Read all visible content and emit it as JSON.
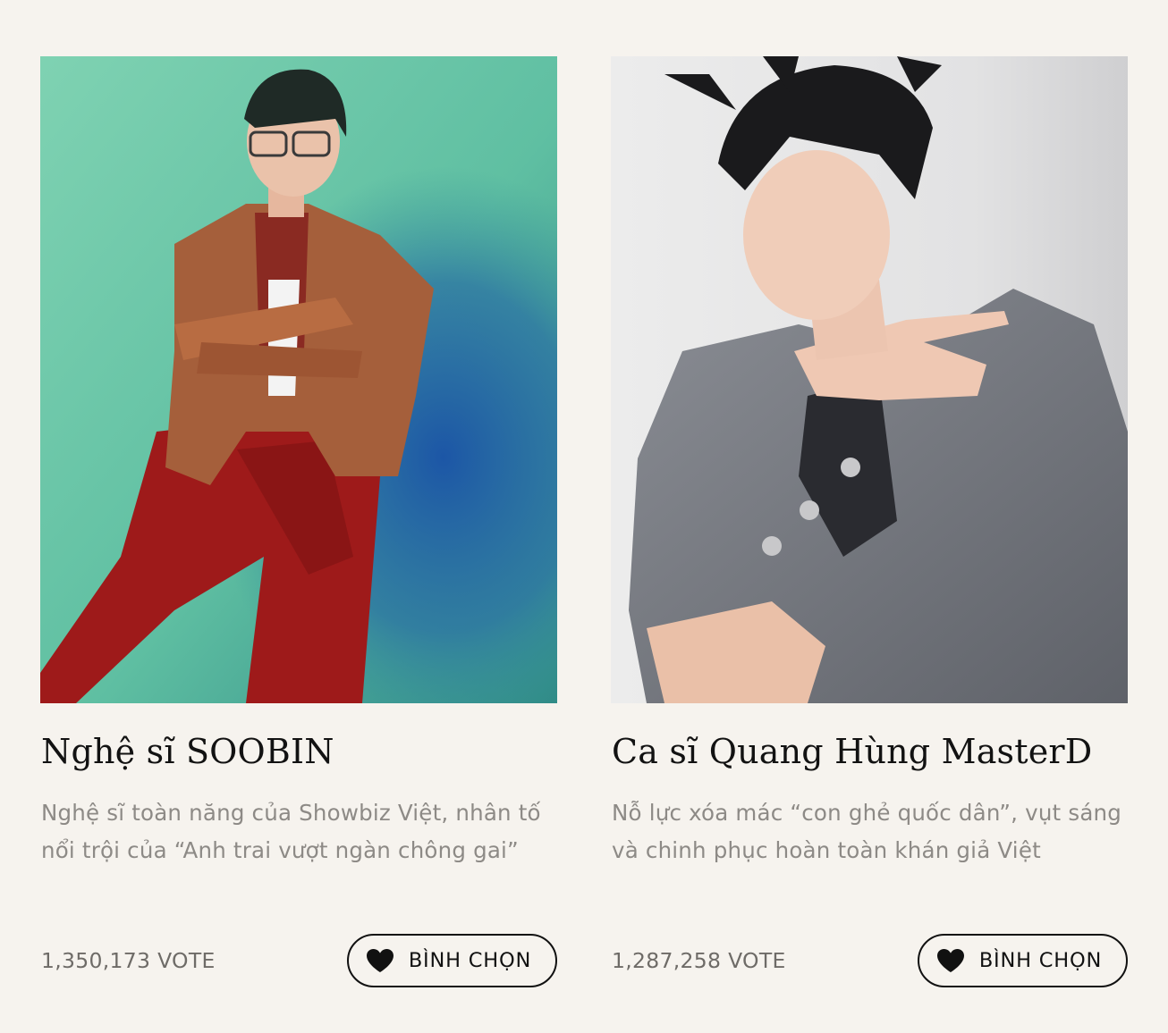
{
  "cards": [
    {
      "name": "Nghệ sĩ SOOBIN",
      "description": "Nghệ sĩ toàn năng của Showbiz Việt, nhân tố nổi trội của “Anh trai vượt ngàn chông gai”",
      "votes": "1,350,173 VOTE",
      "button_label": "BÌNH CHỌN",
      "button_icon": "heart-icon",
      "photo_colors": {
        "background": "#6ec9a5",
        "shadow": "#2d6aa1",
        "cardigan": "#a55f3b",
        "pants": "#9e1a1a"
      }
    },
    {
      "name": "Ca sĩ Quang Hùng MasterD",
      "description": "Nỗ lực xóa mác “con ghẻ quốc dân”, vụt sáng và chinh phục hoàn toàn khán giả Việt",
      "votes": "1,287,258 VOTE",
      "button_label": "BÌNH CHỌN",
      "button_icon": "heart-icon",
      "photo_colors": {
        "background": "#e9e9ea",
        "blazer": "#7c7f86",
        "hair": "#1a1a1c",
        "skin": "#f0cdb9"
      }
    }
  ],
  "colors": {
    "page_background": "#f6f3ee",
    "title": "#121212",
    "description": "#8d8a86",
    "votes": "#6e6b67",
    "button_border": "#111111"
  }
}
